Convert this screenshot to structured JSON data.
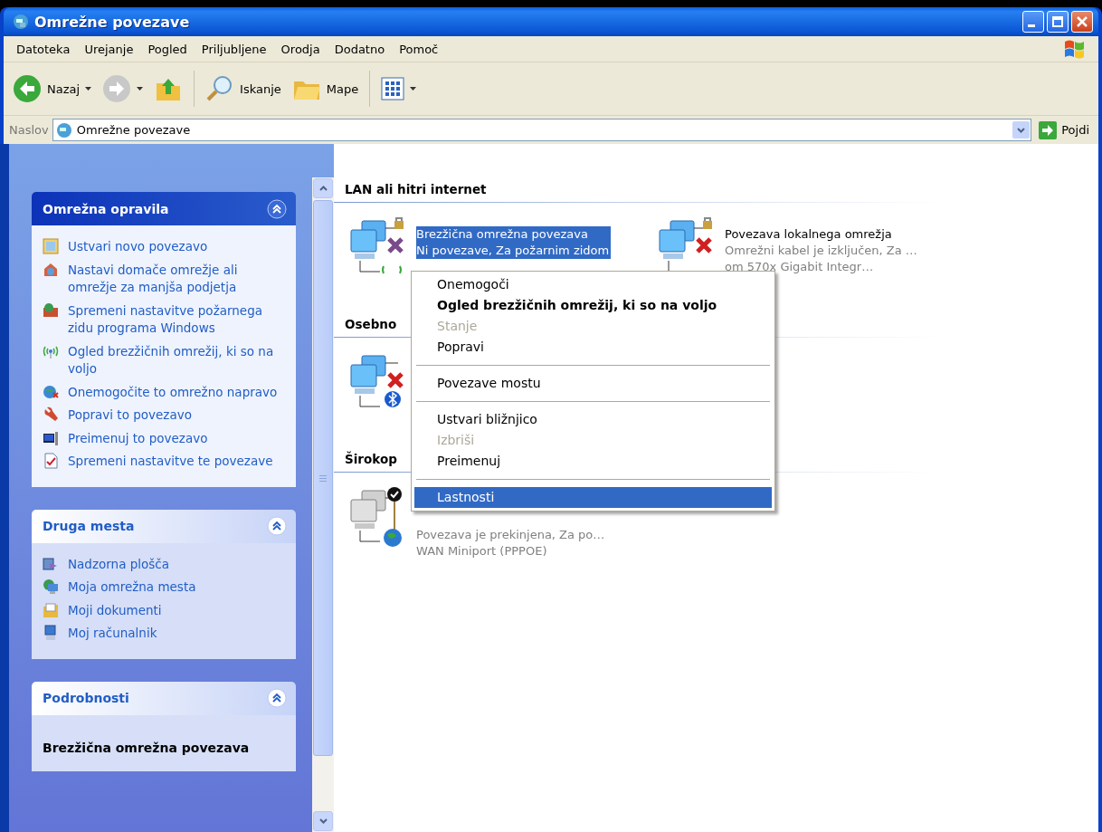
{
  "window": {
    "title": "Omrežne povezave"
  },
  "menu_bar": [
    "Datoteka",
    "Urejanje",
    "Pogled",
    "Priljubljene",
    "Orodja",
    "Dodatno",
    "Pomoč"
  ],
  "toolbar": [
    {
      "kind": "back",
      "label": "Nazaj"
    },
    {
      "kind": "forward"
    },
    {
      "kind": "up"
    },
    {
      "kind": "search",
      "label": "Iskanje"
    },
    {
      "kind": "folders",
      "label": "Mape"
    },
    {
      "kind": "views"
    }
  ],
  "address_bar": {
    "label": "Naslov",
    "value": "Omrežne povezave",
    "go_label": "Pojdi"
  },
  "task_pane": [
    {
      "title": "Omrežna opravila",
      "kind": "special",
      "items": [
        "Ustvari novo povezavo",
        "Nastavi domače omrežje ali omrežje za manjša podjetja",
        "Spremeni nastavitve požarnega zidu programa Windows",
        "Ogled brezžičnih omrežij, ki so na voljo",
        "Onemogočite to omrežno napravo",
        "Popravi to povezavo",
        "Preimenuj to povezavo",
        "Spremeni nastavitve te povezave"
      ]
    },
    {
      "title": "Druga mesta",
      "kind": "normal",
      "items": [
        "Nadzorna plošča",
        "Moja omrežna mesta",
        "Moji dokumenti",
        "Moj računalnik"
      ]
    },
    {
      "title": "Podrobnosti",
      "kind": "normal",
      "details": "Brezžična omrežna povezava"
    }
  ],
  "content": {
    "groups": [
      {
        "title": "LAN ali hitri internet",
        "connections": [
          {
            "kind": "wireless",
            "selected": true,
            "name": "Brezžična omrežna povezava",
            "status": "Ni povezave, Za požarnim zidom"
          },
          {
            "kind": "lan",
            "selected": false,
            "name": "Povezava lokalnega omrežja",
            "status": "Omrežni kabel je izključen, Za …",
            "device": "om 570x Gigabit Integr…"
          }
        ]
      },
      {
        "title": "Osebno",
        "connections": [
          {
            "kind": "bluetooth",
            "selected": false
          }
        ]
      },
      {
        "title": "Širokop",
        "connections": [
          {
            "kind": "broadband",
            "selected": false,
            "status": "Povezava je prekinjena, Za po…",
            "device": "WAN Miniport (PPPOE)"
          }
        ]
      }
    ]
  },
  "context_menu": [
    {
      "kind": "item",
      "label": "Onemogoči",
      "default": false,
      "disabled": false,
      "selected": false
    },
    {
      "kind": "item",
      "label": "Ogled brezžičnih omrežij, ki so na voljo",
      "default": true,
      "disabled": false,
      "selected": false
    },
    {
      "kind": "item",
      "label": "Stanje",
      "default": false,
      "disabled": true,
      "selected": false
    },
    {
      "kind": "item",
      "label": "Popravi",
      "default": false,
      "disabled": false,
      "selected": false
    },
    {
      "kind": "separator"
    },
    {
      "kind": "item",
      "label": "Povezave mostu",
      "default": false,
      "disabled": false,
      "selected": false
    },
    {
      "kind": "separator"
    },
    {
      "kind": "item",
      "label": "Ustvari bližnjico",
      "default": false,
      "disabled": false,
      "selected": false
    },
    {
      "kind": "item",
      "label": "Izbriši",
      "default": false,
      "disabled": true,
      "selected": false
    },
    {
      "kind": "item",
      "label": "Preimenuj",
      "default": false,
      "disabled": false,
      "selected": false
    },
    {
      "kind": "separator"
    },
    {
      "kind": "item",
      "label": "Lastnosti",
      "default": false,
      "disabled": false,
      "selected": true
    }
  ]
}
